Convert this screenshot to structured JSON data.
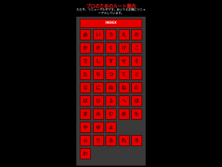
{
  "header": {
    "title": "プロのためのルート案内",
    "notice": "ただ今、リニューアル中です。あいうえお順にリニューアルしています。"
  },
  "nav": {
    "index_label": "INDEX"
  },
  "kana_grid": [
    [
      "あ",
      "い",
      "う",
      "え",
      "お"
    ],
    [
      "か",
      "き",
      "く",
      "け",
      "こ"
    ],
    [
      "さ",
      "し",
      "す",
      "せ",
      "そ"
    ],
    [
      "た",
      "ち",
      "つ",
      "て",
      "と"
    ],
    [
      "な",
      "に",
      "ぬ",
      "ね",
      "の"
    ],
    [
      "は",
      "ひ",
      "ふ",
      "へ",
      "ほ"
    ],
    [
      "ま",
      "み",
      "む",
      "め",
      "も"
    ],
    [
      "や",
      "ゆ",
      "よ",
      "",
      ""
    ],
    [
      "ら",
      "り",
      "る",
      "れ",
      "ろ"
    ],
    [
      "わ",
      "",
      "",
      "",
      ""
    ]
  ],
  "colors": {
    "background": "#000000",
    "panel": "#3a3a3a",
    "button": "#e60000",
    "title": "#ff1a1a"
  }
}
